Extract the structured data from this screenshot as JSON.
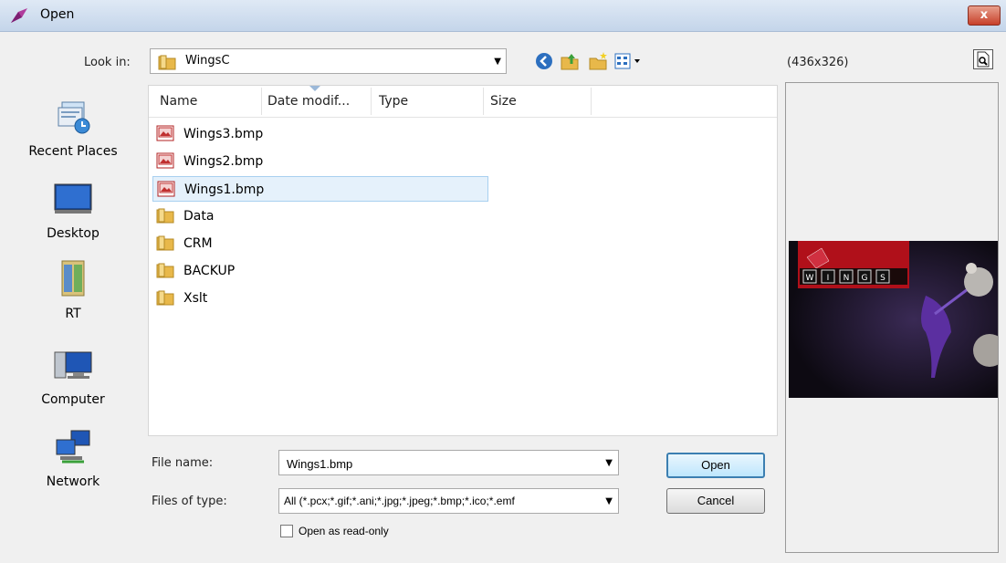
{
  "window": {
    "title": "Open",
    "close_glyph": "x"
  },
  "look_in": {
    "label": "Look in:",
    "value": "WingsC"
  },
  "preview": {
    "dimensions": "(436x326)",
    "banner_letters": [
      "W",
      "I",
      "N",
      "G",
      "S"
    ]
  },
  "places": [
    {
      "label": "Recent Places",
      "icon": "recent-places-icon"
    },
    {
      "label": "Desktop",
      "icon": "desktop-icon"
    },
    {
      "label": "RT",
      "icon": "rt-folder-icon"
    },
    {
      "label": "Computer",
      "icon": "computer-icon"
    },
    {
      "label": "Network",
      "icon": "network-icon"
    }
  ],
  "columns": [
    "Name",
    "Date modif...",
    "Type",
    "Size"
  ],
  "files": [
    {
      "name": "Wings3.bmp",
      "kind": "bmp",
      "selected": false
    },
    {
      "name": "Wings2.bmp",
      "kind": "bmp",
      "selected": false
    },
    {
      "name": "Wings1.bmp",
      "kind": "bmp",
      "selected": true
    },
    {
      "name": "Data",
      "kind": "folder",
      "selected": false
    },
    {
      "name": "CRM",
      "kind": "folder",
      "selected": false
    },
    {
      "name": "BACKUP",
      "kind": "folder",
      "selected": false
    },
    {
      "name": "Xslt",
      "kind": "folder",
      "selected": false
    }
  ],
  "file_name": {
    "label": "File name:",
    "value": "Wings1.bmp"
  },
  "file_type": {
    "label": "Files of type:",
    "value": "All (*.pcx;*.gif;*.ani;*.jpg;*.jpeg;*.bmp;*.ico;*.emf"
  },
  "read_only": {
    "label": "Open as read-only",
    "checked": false
  },
  "buttons": {
    "open": "Open",
    "cancel": "Cancel"
  },
  "colors": {
    "selection_bg": "#e5f1fb",
    "selection_border": "#a8d0f0",
    "folder": "#e8b84a",
    "close": "#c7402a"
  }
}
